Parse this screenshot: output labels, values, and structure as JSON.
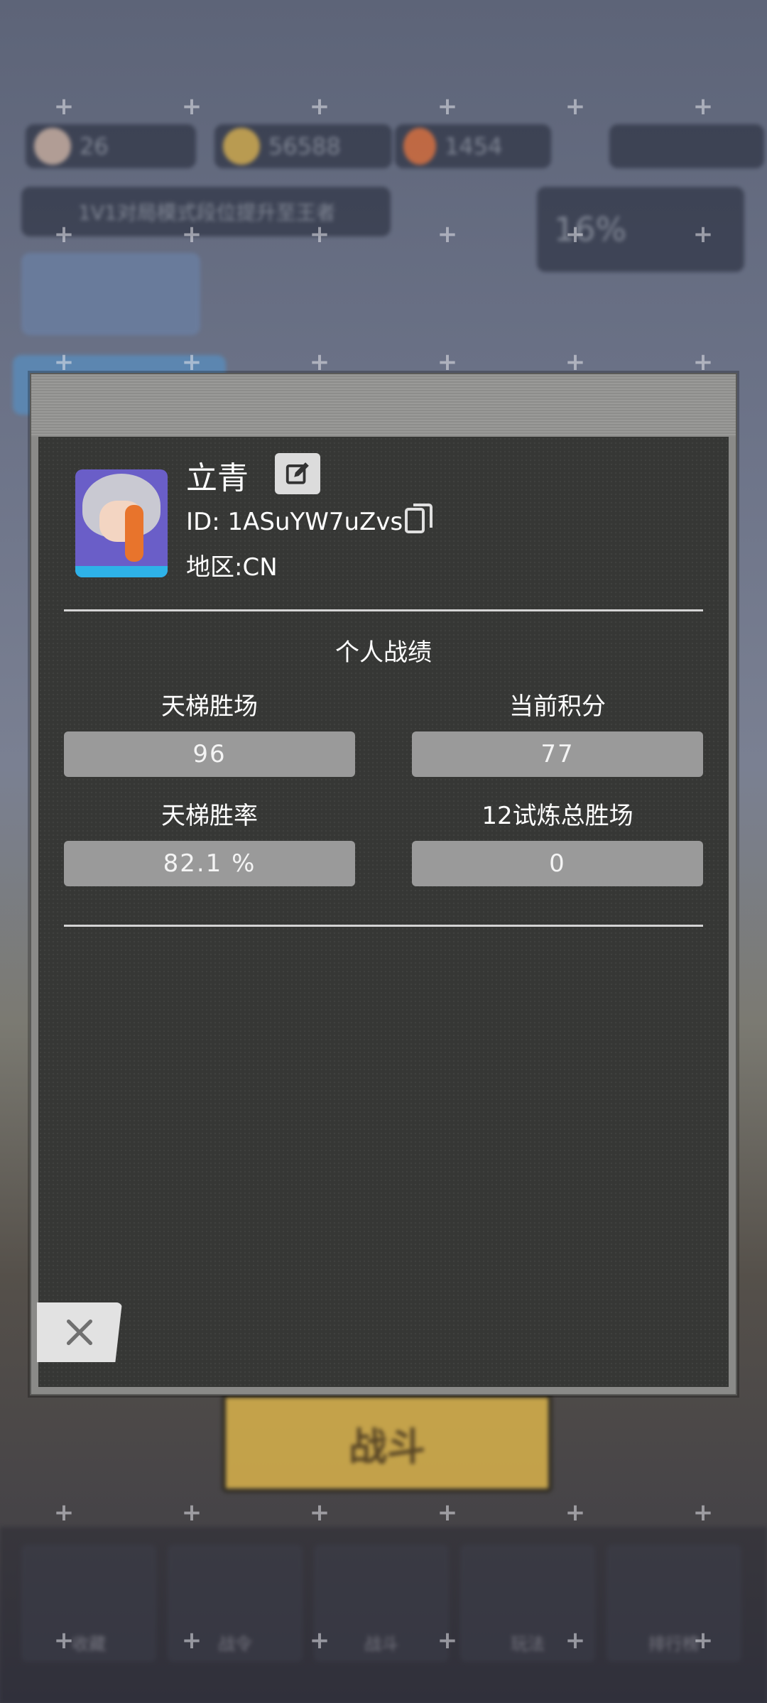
{
  "background": {
    "resources": [
      "26",
      "56588",
      "1454"
    ],
    "notice": "1V1对局模式段位提升至王者",
    "progress": "16%",
    "battle_button": "战斗",
    "nav_tabs": [
      "收藏",
      "战令",
      "战斗",
      "玩法",
      "排行榜"
    ]
  },
  "profile": {
    "name": "立青",
    "id_text": "ID: 1ASuYW7uZvs",
    "region_text": "地区:CN"
  },
  "stats": {
    "title": "个人战绩",
    "ladder_wins_label": "天梯胜场",
    "ladder_wins_value": "96",
    "current_points_label": "当前积分",
    "current_points_value": "77",
    "ladder_winrate_label": "天梯胜率",
    "ladder_winrate_value": "82.1 %",
    "trial_wins_label": "12试炼总胜场",
    "trial_wins_value": "0"
  },
  "icons": {
    "edit": "edit-icon",
    "copy": "copy-icon",
    "close": "close-icon"
  },
  "colors": {
    "panel_bg": "#363735",
    "stat_box": "#9a9a9a",
    "avatar_bar": "#2eb2e8"
  }
}
